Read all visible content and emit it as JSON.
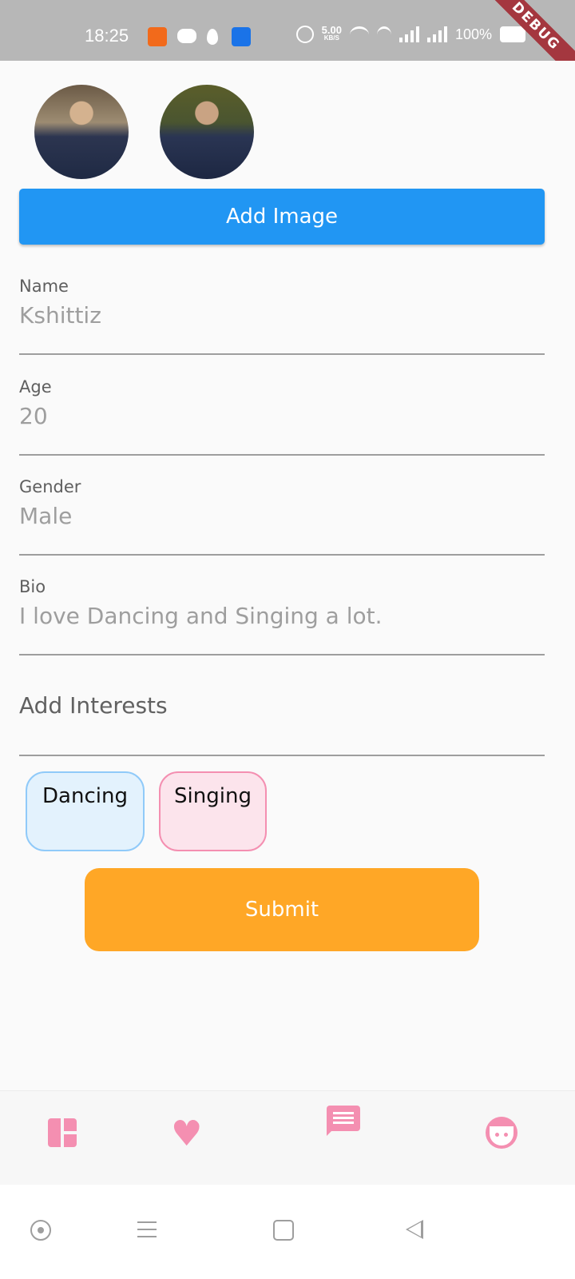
{
  "status_bar": {
    "time": "18:25",
    "net_speed": "5.00",
    "net_speed_unit": "KB/S",
    "battery": "100%",
    "debug_label": "DEBUG"
  },
  "profile": {
    "add_image_label": "Add Image",
    "fields": [
      {
        "label": "Name",
        "value": "Kshittiz"
      },
      {
        "label": "Age",
        "value": "20"
      },
      {
        "label": "Gender",
        "value": "Male"
      },
      {
        "label": "Bio",
        "value": "I love Dancing and Singing a lot."
      }
    ],
    "interests_placeholder": "Add Interests",
    "interests": [
      "Dancing",
      "Singing"
    ],
    "submit_label": "Submit"
  },
  "colors": {
    "primary": "#2196f3",
    "accent": "#f48fb1",
    "submit": "#ffa726"
  },
  "bottom_nav": {
    "items": [
      "dashboard-icon",
      "heart-icon",
      "chat-icon",
      "face-icon"
    ]
  }
}
